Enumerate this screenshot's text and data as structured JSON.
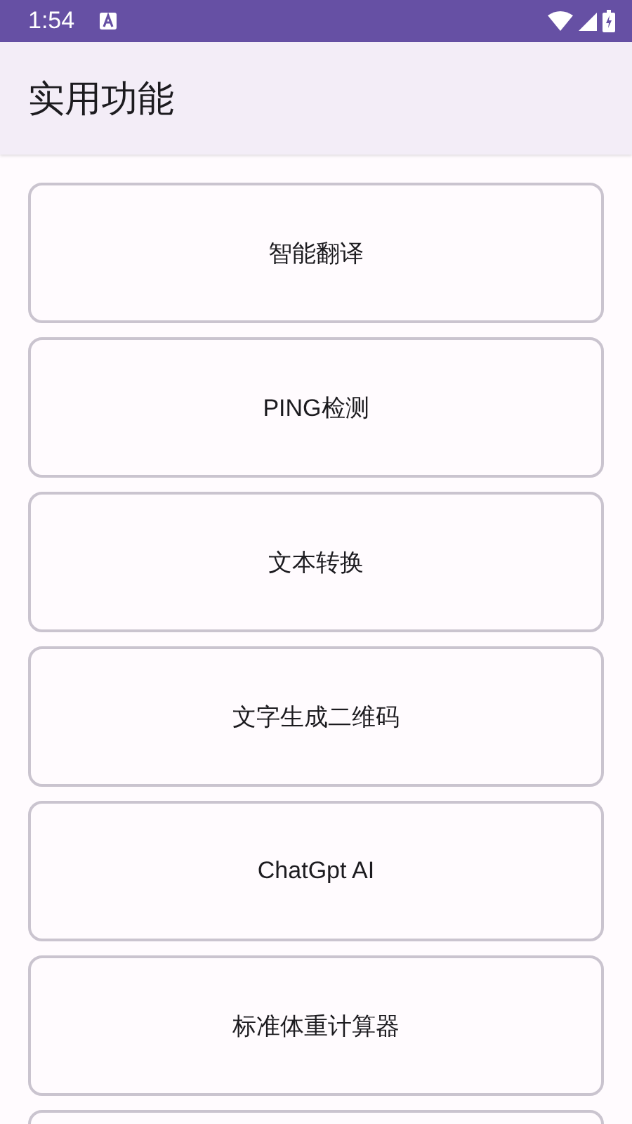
{
  "status_bar": {
    "time": "1:54"
  },
  "app_bar": {
    "title": "实用功能"
  },
  "items": [
    {
      "kind": "button",
      "label": "智能翻译"
    },
    {
      "kind": "button",
      "label": "PING检测"
    },
    {
      "kind": "button",
      "label": "文本转换"
    },
    {
      "kind": "button",
      "label": "文字生成二维码"
    },
    {
      "kind": "button",
      "label": "ChatGpt AI"
    },
    {
      "kind": "button",
      "label": "标准体重计算器"
    },
    {
      "kind": "partial"
    }
  ]
}
